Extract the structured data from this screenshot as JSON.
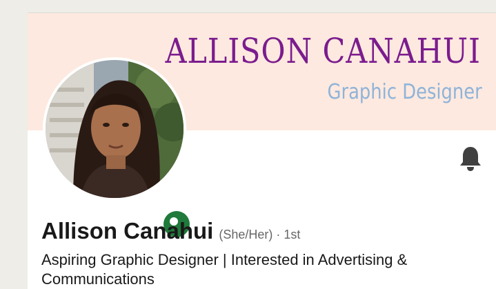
{
  "banner": {
    "name": "ALLISON CANAHUI",
    "role": "Graphic Designer",
    "background": "#fde9df",
    "name_color": "#7b1c8e",
    "role_color": "#8fb3d9"
  },
  "profile": {
    "name": "Allison Canahui",
    "pronouns": "(She/Her)",
    "degree_separator": " · ",
    "degree": "1st",
    "headline": "Aspiring Graphic Designer | Interested in Advertising & Communications",
    "status": "open-to-work",
    "status_color": "#1f7a3b"
  },
  "icons": {
    "notify": "bell-icon"
  }
}
